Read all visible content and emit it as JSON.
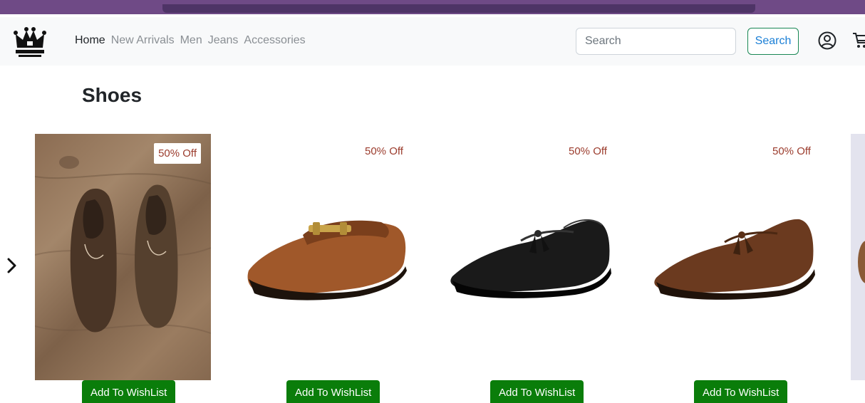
{
  "navbar": {
    "links": [
      {
        "label": "Home",
        "active": true
      },
      {
        "label": "New Arrivals",
        "active": false
      },
      {
        "label": "Men",
        "active": false
      },
      {
        "label": "Jeans",
        "active": false
      },
      {
        "label": "Accessories",
        "active": false
      }
    ],
    "search": {
      "placeholder": "Search",
      "value": ""
    },
    "search_button_label": "Search",
    "icons": [
      "crown-logo",
      "user-circle-icon",
      "cart-icon"
    ]
  },
  "page": {
    "title": "Shoes"
  },
  "carousel": {
    "next_icon": "chevron-right-icon"
  },
  "products": [
    {
      "discount": "50% Off",
      "wishlist_label": "Add To WishList",
      "image": "brown-lace-up-oxfords-on-wood"
    },
    {
      "discount": "50% Off",
      "wishlist_label": "Add To WishList",
      "image": "tan-horsebit-loafer"
    },
    {
      "discount": "50% Off",
      "wishlist_label": "Add To WishList",
      "image": "black-tassel-loafer"
    },
    {
      "discount": "50% Off",
      "wishlist_label": "Add To WishList",
      "image": "brown-tassel-loafer"
    }
  ],
  "colors": {
    "top_bar": "#6f4a86",
    "navbar_bg": "#f8f9fa",
    "wishlist_button": "#0a7d0a",
    "discount_text": "#9b3b2c",
    "search_button_border": "#198754"
  }
}
